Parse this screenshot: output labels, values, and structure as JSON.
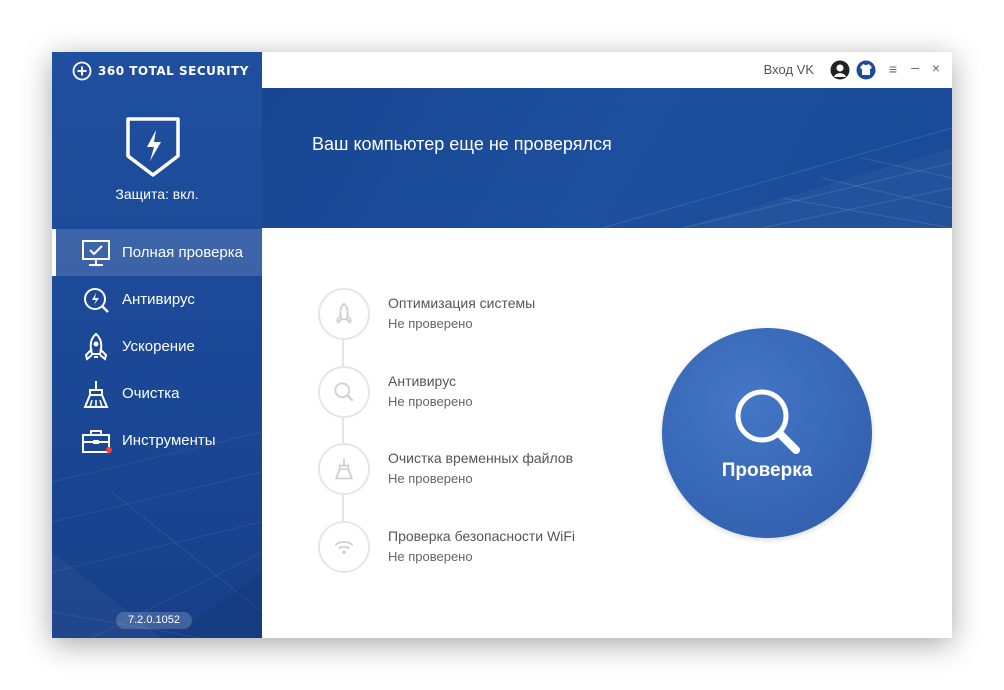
{
  "app": {
    "logo_text": "360 TOTAL SECURITY",
    "version": "7.2.0.1052"
  },
  "protection": {
    "status": "Защита: вкл."
  },
  "sidebar": {
    "items": [
      {
        "label": "Полная проверка",
        "icon": "monitor-check-icon",
        "active": true
      },
      {
        "label": "Антивирус",
        "icon": "antivirus-icon"
      },
      {
        "label": "Ускорение",
        "icon": "rocket-icon"
      },
      {
        "label": "Очистка",
        "icon": "broom-icon"
      },
      {
        "label": "Инструменты",
        "icon": "toolbox-icon",
        "badge": true
      }
    ]
  },
  "titlebar": {
    "login_label": "Вход VK"
  },
  "banner": {
    "title": "Ваш компьютер еще не проверялся"
  },
  "checks": [
    {
      "title": "Оптимизация системы",
      "status": "Не проверено",
      "icon": "rocket-icon"
    },
    {
      "title": "Антивирус",
      "status": "Не проверено",
      "icon": "magnifier-icon"
    },
    {
      "title": "Очистка временных файлов",
      "status": "Не проверено",
      "icon": "broom-icon"
    },
    {
      "title": "Проверка безопасности WiFi",
      "status": "Не проверено",
      "icon": "wifi-icon"
    }
  ],
  "scan": {
    "label": "Проверка"
  },
  "colors": {
    "sidebar": "#1d4c9a",
    "banner": "#1a4a96",
    "scan_button": "#3a6aba",
    "inactive_icon": "#d0d0d0"
  }
}
